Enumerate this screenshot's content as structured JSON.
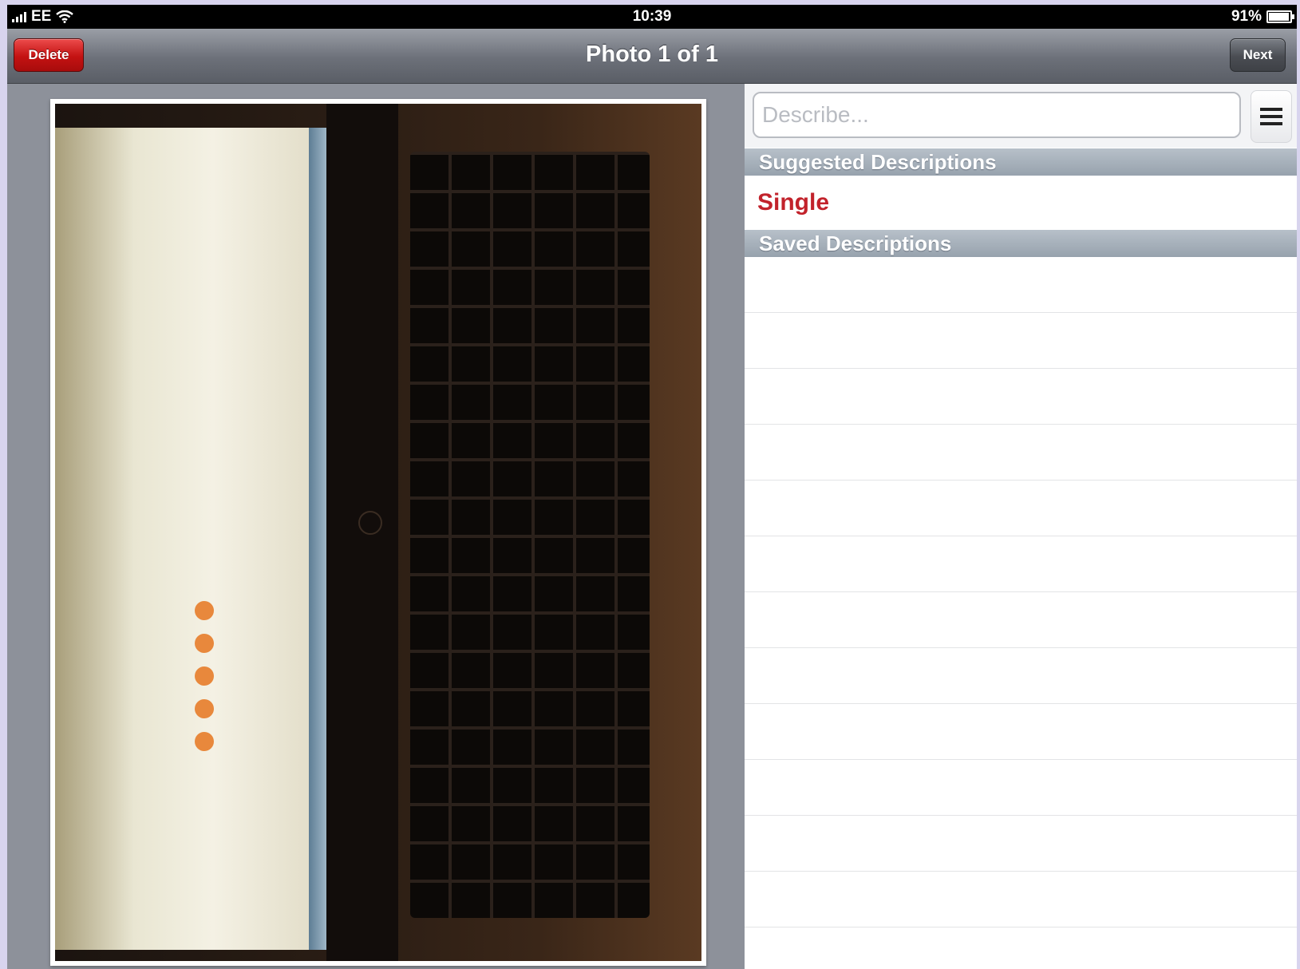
{
  "status_bar": {
    "carrier": "EE",
    "time": "10:39",
    "battery": "91%"
  },
  "nav_bar": {
    "title": "Photo 1 of 1",
    "delete_label": "Delete",
    "next_label": "Next"
  },
  "describe": {
    "placeholder": "Describe...",
    "value": ""
  },
  "suggested": {
    "header": "Suggested Descriptions",
    "items": [
      "Single"
    ]
  },
  "saved": {
    "header": "Saved Descriptions",
    "items": []
  },
  "colors": {
    "delete_button": "#c41212",
    "suggestion_text": "#c2222b",
    "section_header": "#a3adb8"
  }
}
